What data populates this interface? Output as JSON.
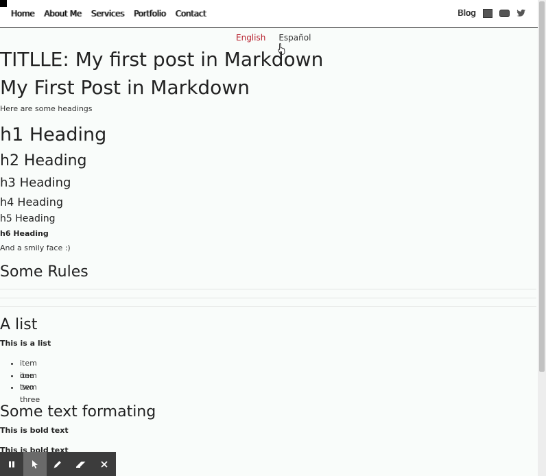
{
  "nav": {
    "links": [
      "Home",
      "About Me",
      "Services",
      "Portfolio",
      "Contact"
    ],
    "blog_label": "Blog",
    "social_icons": [
      "square-icon",
      "youtube-icon",
      "twitter-icon"
    ]
  },
  "languages": {
    "active": "English",
    "other": "Español",
    "active_color": "#b7202d"
  },
  "post": {
    "title_line": "TITLLE: My first post in Markdown",
    "heading": "My First Post in Markdown",
    "intro": "Here are some headings",
    "headings": {
      "h1": "h1 Heading",
      "h2": "h2 Heading",
      "h3": "h3 Heading",
      "h4": "h4 Heading",
      "h5": "h5 Heading",
      "h6": "h6 Heading"
    },
    "smiley": "And a smily face :)",
    "rules_heading": "Some Rules",
    "list_heading": "A list",
    "list_intro": "This is a list",
    "list_items": [
      "item one",
      "item two",
      "item three"
    ],
    "formatting_heading": "Some text formating",
    "bold_1": "This is bold text",
    "bold_2": "This is bold text"
  },
  "toolbar": {
    "tools": [
      "pause-icon",
      "pointer-icon",
      "pen-icon",
      "eraser-icon",
      "close-icon"
    ],
    "selected": "pointer-icon"
  }
}
